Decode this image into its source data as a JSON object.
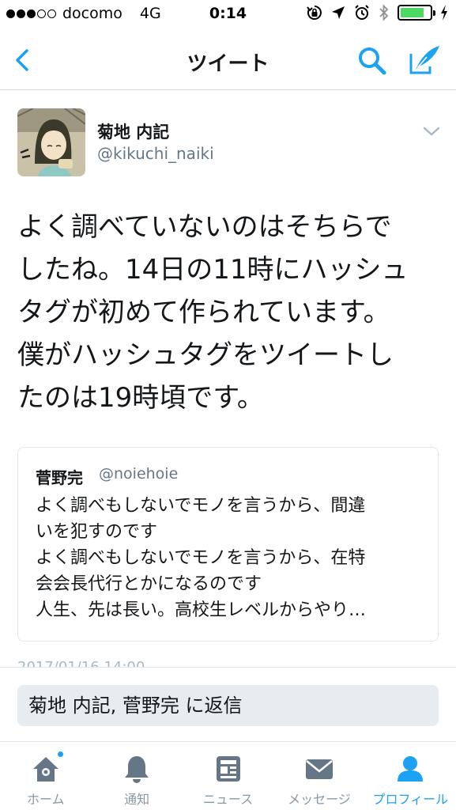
{
  "status_bar": {
    "carrier": "docomo",
    "network": "4G",
    "time": "0:14",
    "battery_level": 0.8
  },
  "nav": {
    "title": "ツイート",
    "back_icon": "chevron-left-icon",
    "search_icon": "search-icon",
    "compose_icon": "compose-tweet-icon"
  },
  "tweet": {
    "author_name": "菊地 内記",
    "author_handle": "@kikuchi_naiki",
    "text_lines": [
      "よく調べていないのはそちらで",
      "したね。14日の11時にハッシュ",
      "タグが初めて作られています。",
      "僕がハッシュタグをツイートし",
      "たのは19時頃です。"
    ],
    "quoted": {
      "author_name": "菅野完",
      "author_handle": "@noiehoie",
      "text_lines": [
        "よく調べもしないでモノを言うから、間違",
        "いを犯すのです",
        "よく調べもしないでモノを言うから、在特",
        "会会長代行とかになるのです",
        "人生、先は長い。高校生レベルからやり…"
      ]
    },
    "timestamp_partial": "2017/01/16 14:00"
  },
  "reply": {
    "placeholder": "菊地 内記, 菅野完 に返信"
  },
  "tabs": [
    {
      "label": "ホーム",
      "icon": "home-icon",
      "active": false,
      "badge": true
    },
    {
      "label": "通知",
      "icon": "bell-icon",
      "active": false,
      "badge": false
    },
    {
      "label": "ニュース",
      "icon": "news-icon",
      "active": false,
      "badge": false
    },
    {
      "label": "メッセージ",
      "icon": "envelope-icon",
      "active": false,
      "badge": false
    },
    {
      "label": "プロフィール",
      "icon": "profile-icon",
      "active": true,
      "badge": false
    }
  ],
  "colors": {
    "accent": "#1da1f2",
    "text": "#14171a",
    "secondary_text": "#657786",
    "inactive_icon": "#657786",
    "battery": "#4cd964"
  }
}
